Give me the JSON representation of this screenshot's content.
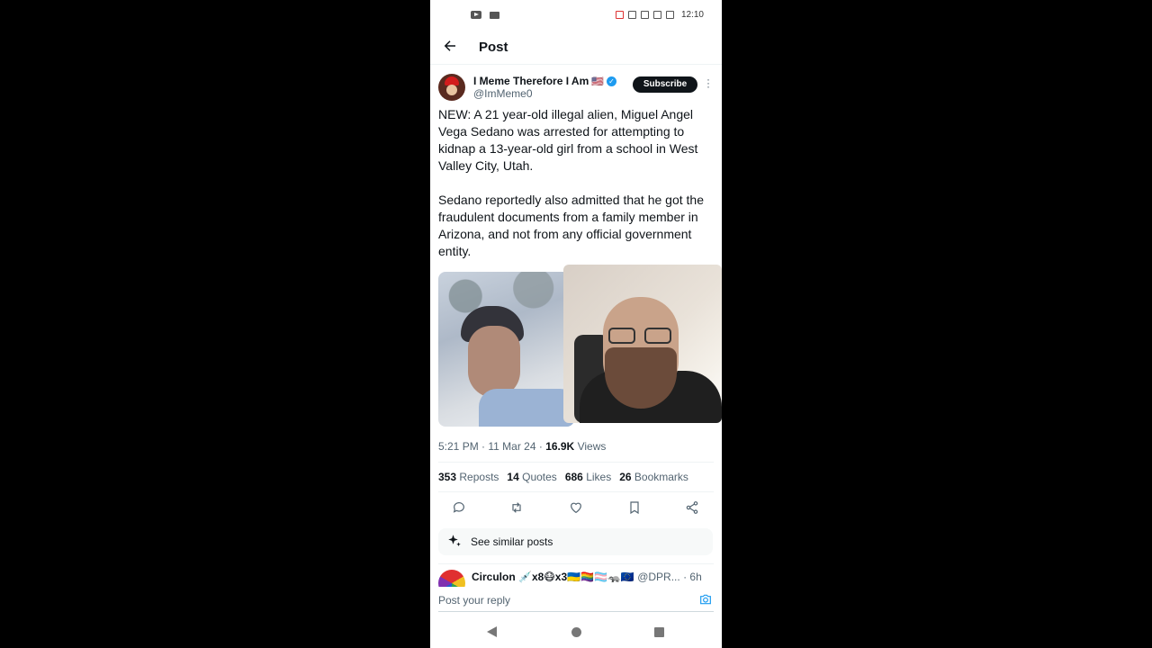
{
  "status_bar": {
    "time": "12:10"
  },
  "header": {
    "title": "Post"
  },
  "author": {
    "name": "I Meme Therefore I Am",
    "flag": "🇺🇸",
    "handle": "@ImMeme0",
    "subscribe_label": "Subscribe"
  },
  "post": {
    "text": "NEW: A 21 year-old illegal alien, Miguel Angel Vega Sedano was arrested for attempting to kidnap a 13-year-old girl from a school in West Valley City, Utah.\n\nSedano reportedly also admitted that he got the fraudulent documents from a family member in Arizona, and not from any official government entity.",
    "time": "5:21 PM",
    "date": "11 Mar 24",
    "views_count": "16.9K",
    "views_label": "Views"
  },
  "stats": {
    "reposts_count": "353",
    "reposts_label": "Reposts",
    "quotes_count": "14",
    "quotes_label": "Quotes",
    "likes_count": "686",
    "likes_label": "Likes",
    "bookmarks_count": "26",
    "bookmarks_label": "Bookmarks"
  },
  "actions": [
    "reply-icon",
    "repost-icon",
    "like-icon",
    "bookmark-icon",
    "share-icon"
  ],
  "similar_posts_label": "See similar posts",
  "reply_preview": {
    "name": "Circulon 💉x8😷x3🇺🇦🏳️‍🌈🏳️‍⚧️🦡🇪🇺",
    "handle": "@DPR...",
    "age": "6h"
  },
  "compose": {
    "placeholder": "Post your reply"
  },
  "colors": {
    "accent": "#1d9bf0",
    "text": "#0f1419",
    "muted": "#536471"
  }
}
